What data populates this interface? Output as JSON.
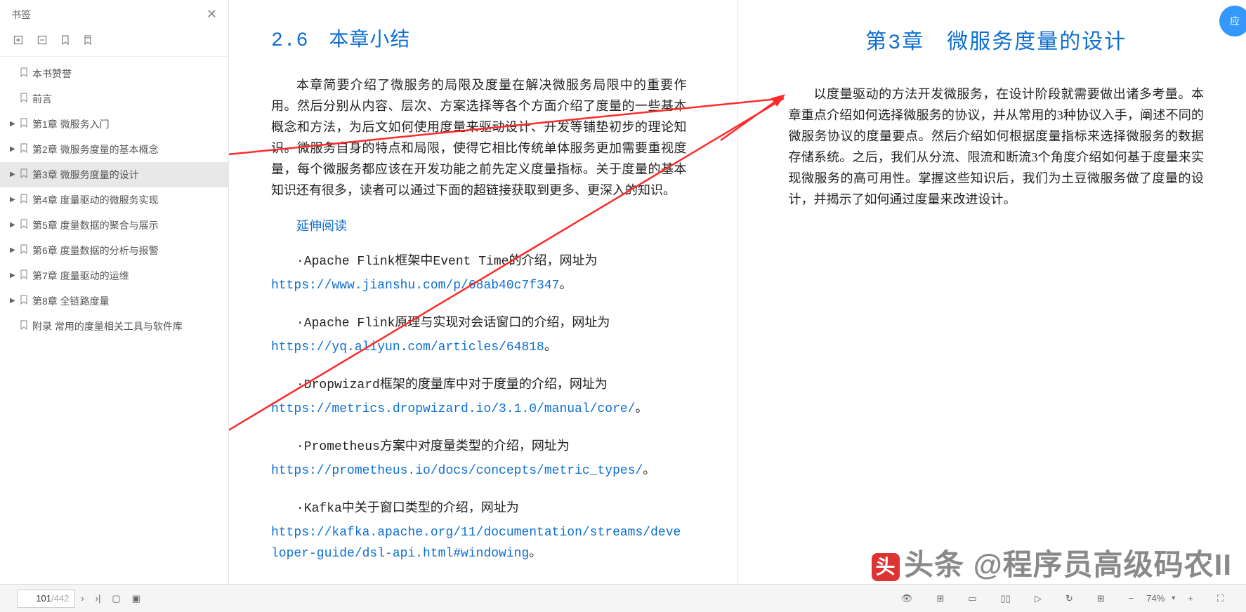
{
  "sidebar": {
    "title": "书签",
    "items": [
      {
        "expandable": false,
        "label": "本书赞誉"
      },
      {
        "expandable": false,
        "label": "前言"
      },
      {
        "expandable": true,
        "label": "第1章 微服务入门"
      },
      {
        "expandable": true,
        "label": "第2章 微服务度量的基本概念"
      },
      {
        "expandable": true,
        "label": "第3章 微服务度量的设计",
        "active": true
      },
      {
        "expandable": true,
        "label": "第4章 度量驱动的微服务实现"
      },
      {
        "expandable": true,
        "label": "第5章 度量数据的聚合与展示"
      },
      {
        "expandable": true,
        "label": "第6章 度量数据的分析与报警"
      },
      {
        "expandable": true,
        "label": "第7章 度量驱动的运维"
      },
      {
        "expandable": true,
        "label": "第8章 全链路度量"
      },
      {
        "expandable": false,
        "label": "附录 常用的度量相关工具与软件库"
      }
    ]
  },
  "left_page": {
    "heading": "2.6　本章小结",
    "para": "本章简要介绍了微服务的局限及度量在解决微服务局限中的重要作用。然后分别从内容、层次、方案选择等各个方面介绍了度量的一些基本概念和方法，为后文如何使用度量来驱动设计、开发等铺垫初步的理论知识。微服务自身的特点和局限，使得它相比传统单体服务更加需要重视度量，每个微服务都应该在开发功能之前先定义度量指标。关于度量的基本知识还有很多，读者可以通过下面的超链接获取到更多、更深入的知识。",
    "sub_heading": "延伸阅读",
    "refs": [
      {
        "text": "·Apache Flink框架中Event Time的介绍，网址为",
        "link": "https://www.jianshu.com/p/68ab40c7f347"
      },
      {
        "text": "·Apache Flink原理与实现对会话窗口的介绍，网址为",
        "link": "https://yq.aliyun.com/articles/64818"
      },
      {
        "text": "·Dropwizard框架的度量库中对于度量的介绍，网址为",
        "link": "https://metrics.dropwizard.io/3.1.0/manual/core/"
      },
      {
        "text": "·Prometheus方案中对度量类型的介绍，网址为",
        "link": "https://prometheus.io/docs/concepts/metric_types/"
      },
      {
        "text": "·Kafka中关于窗口类型的介绍，网址为",
        "link": "https://kafka.apache.org/11/documentation/streams/developer-guide/dsl-api.html#windowing"
      }
    ]
  },
  "right_page": {
    "heading": "第3章　微服务度量的设计",
    "para": "以度量驱动的方法开发微服务，在设计阶段就需要做出诸多考量。本章重点介绍如何选择微服务的协议，并从常用的3种协议入手，阐述不同的微服务协议的度量要点。然后介绍如何根据度量指标来选择微服务的数据存储系统。之后，我们从分流、限流和断流3个角度介绍如何基于度量来实现微服务的高可用性。掌握这些知识后，我们为土豆微服务做了度量的设计，并揭示了如何通过度量来改进设计。"
  },
  "footer": {
    "page_current": "101",
    "page_total": "/442",
    "zoom": "74%"
  },
  "watermark": "头条 @程序员高级码农II",
  "badge": "应"
}
